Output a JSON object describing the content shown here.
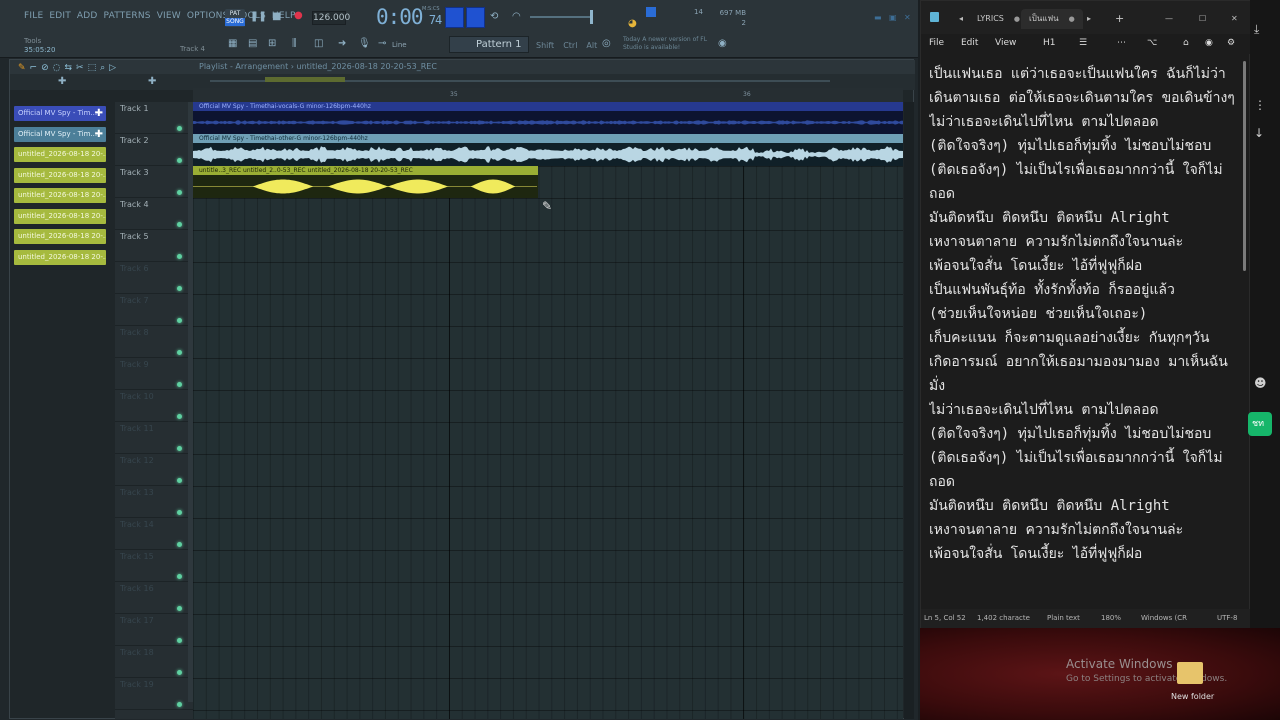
{
  "fl": {
    "menu": [
      "FILE",
      "EDIT",
      "ADD",
      "PATTERNS",
      "VIEW",
      "OPTIONS",
      "TOOLS",
      "HELP"
    ],
    "hint_label": "Tools",
    "hint_time": "35:05:20",
    "hint_track": "Track 4",
    "song_mode_top": "PAT",
    "song_mode": "SONG",
    "tempo": "126.000",
    "time_main": "0:00",
    "time_sub": "74",
    "time_label": "M:S:CS",
    "cpu_top": "697 MB",
    "cpu_mid": "14",
    "cpu_bot": "2",
    "snap": "Line",
    "pattern": "Pattern 1",
    "mode_buttons": [
      "Shift",
      "Ctrl",
      "Alt"
    ],
    "news": "Today A newer version of FL Studio is available!",
    "playlist_title": "Playlist - Arrangement",
    "playlist_sep": "›",
    "playlist_clip": "untitled_2026-08-18 20-20-53_REC",
    "ruler_labels": [
      "35",
      "36"
    ],
    "tracks": [
      "Track 1",
      "Track 2",
      "Track 3",
      "Track 4",
      "Track 5",
      "Track 6",
      "Track 7",
      "Track 8",
      "Track 9",
      "Track 10",
      "Track 11",
      "Track 12",
      "Track 13",
      "Track 14",
      "Track 15",
      "Track 16",
      "Track 17",
      "Track 18",
      "Track 19"
    ],
    "clips": {
      "c1": "Official MV  Spy - Timethai-vocals-G minor-126bpm-440hz",
      "c2": "Official MV  Spy - Timethai-other-G minor-126bpm-440hz",
      "c3a": "untitle..3_REC",
      "c3b": "untitled_2..0-53_REC",
      "c3c": "untitled_2026-08-18 20-20-53_REC"
    },
    "picker": [
      {
        "label": "Official MV  Spy - Tim...",
        "style": "blue"
      },
      {
        "label": "Official MV  Spy - Tim...",
        "style": "lblue"
      },
      {
        "label": "untitled_2026-08-18 20-...",
        "style": "yel"
      },
      {
        "label": "untitled_2026-08-18 20-...",
        "style": "yel"
      },
      {
        "label": "untitled_2026-08-18 20-...",
        "style": "yel"
      },
      {
        "label": "untitled_2026-08-18 20-...",
        "style": "yel"
      },
      {
        "label": "untitled_2026-08-18 20-...",
        "style": "yel"
      },
      {
        "label": "untitled_2026-08-18 20-...",
        "style": "yel"
      }
    ],
    "colors": {
      "accent": "#2a6cd6",
      "track_dot": "#5fd0a1",
      "clip_vocals": "#26398f",
      "clip_other": "#6fa0b6",
      "clip_rec": "#9aae34"
    }
  },
  "notepad": {
    "tabs": [
      "LYRICS",
      "เป็นแฟน"
    ],
    "menu": [
      "File",
      "Edit",
      "View"
    ],
    "heading": "H1",
    "text": "เป็นแฟนเธอ แต่ว่าเธอจะเป็นแฟนใคร ฉันก็ไม่ว่า\nเดินตามเธอ ต่อให้เธอจะเดินตามใคร ขอเดินข้างๆ\nไม่ว่าเธอจะเดินไปที่ไหน ตามไปตลอด\n(ติดใจจริงๆ) ทุ่มไปเธอก็ทุ่มทิ้ง ไม่ชอบไม่ชอบ\n(ติดเธอจังๆ) ไม่เป็นไรเพื่อเธอมากกว่านี้ ใจก็ไม่ถอด\nมันติดหนึบ ติดหนึบ ติดหนึบ Alright\nเหงาจนตาลาย ความรักไม่ตกถึงใจนานล่ะ\nเพ้อจนใจสั่น โดนเงี้ยะ ไอ้ที่ฟูฟูก็ฝอ\nเป็นแฟนพันธุ์ท้อ ทั้งรักทั้งท้อ ก็รออยู่แล้ว\n(ช่วยเห็นใจหน่อย ช่วยเห็นใจเถอะ)\nเก็บคะแนน ก็จะตามดูแลอย่างเงี้ยะ กันทุกๆวัน\nเกิดอารมณ์ อยากให้เธอมามองมามอง มาเห็นฉันมั่ง\nไม่ว่าเธอจะเดินไปที่ไหน ตามไปตลอด\n(ติดใจจริงๆ) ทุ่มไปเธอก็ทุ่มทิ้ง ไม่ชอบไม่ชอบ\n(ติดเธอจังๆ) ไม่เป็นไรเพื่อเธอมากกว่านี้ ใจก็ไม่ถอด\nมันติดหนึบ ติดหนึบ ติดหนึบ Alright\nเหงาจนตาลาย ความรักไม่ตกถึงใจนานล่ะ\nเพ้อจนใจสั่น โดนเงี้ยะ ไอ้ที่ฟูฟูก็ฝอ",
    "status": {
      "pos": "Ln 5, Col 52",
      "chars": "1,402 characte",
      "type": "Plain text",
      "zoom": "180%",
      "eol": "Windows (CR",
      "enc": "UTF-8"
    }
  },
  "desktop": {
    "activate_title": "Activate Windows",
    "activate_sub": "Go to Settings to activate Windows.",
    "folder": "New folder",
    "chat": "ชท"
  }
}
